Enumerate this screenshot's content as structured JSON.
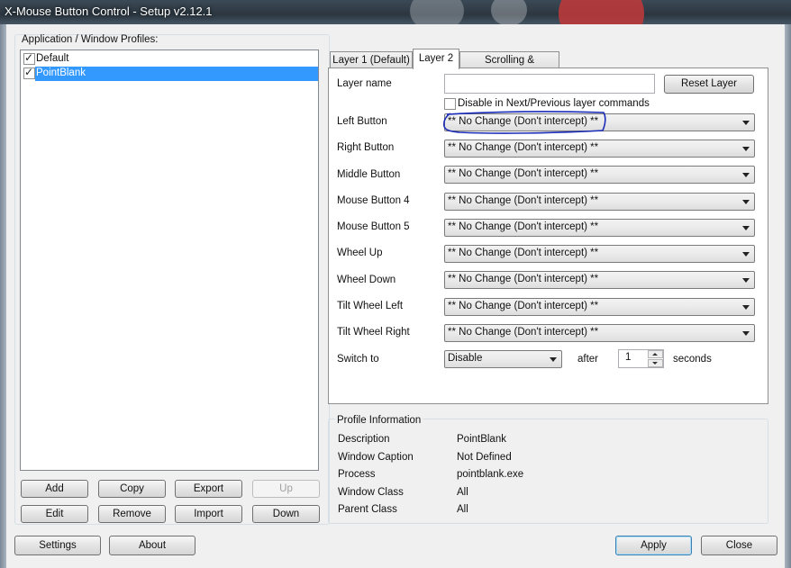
{
  "window": {
    "title": "X-Mouse Button Control - Setup v2.12.1"
  },
  "profiles": {
    "heading": "Application / Window Profiles:",
    "items": [
      {
        "label": "Default",
        "checked": true,
        "selected": false
      },
      {
        "label": "PointBlank",
        "checked": true,
        "selected": true
      }
    ],
    "buttons": {
      "add": "Add",
      "copy": "Copy",
      "export": "Export",
      "up": "Up",
      "edit": "Edit",
      "remove": "Remove",
      "import": "Import",
      "down": "Down"
    }
  },
  "tabs": [
    {
      "label": "Layer 1 (Default)",
      "active": false
    },
    {
      "label": "Layer 2",
      "active": true
    },
    {
      "label": "Scrolling & Navigation",
      "active": false
    }
  ],
  "layer": {
    "name_label": "Layer name",
    "name_value": "",
    "reset_button": "Reset Layer",
    "disable_label": "Disable in Next/Previous layer commands",
    "disable_checked": false,
    "rows": [
      {
        "label": "Left Button",
        "value": "** No Change (Don't intercept) **"
      },
      {
        "label": "Right Button",
        "value": "** No Change (Don't intercept) **"
      },
      {
        "label": "Middle Button",
        "value": "** No Change (Don't intercept) **"
      },
      {
        "label": "Mouse Button 4",
        "value": "** No Change (Don't intercept) **"
      },
      {
        "label": "Mouse Button 5",
        "value": "** No Change (Don't intercept) **"
      },
      {
        "label": "Wheel Up",
        "value": "** No Change (Don't intercept) **"
      },
      {
        "label": "Wheel Down",
        "value": "** No Change (Don't intercept) **"
      },
      {
        "label": "Tilt Wheel Left",
        "value": "** No Change (Don't intercept) **"
      },
      {
        "label": "Tilt Wheel Right",
        "value": "** No Change (Don't intercept) **"
      }
    ],
    "switch_label": "Switch to",
    "switch_value": "Disable",
    "after_label": "after",
    "after_value": "1",
    "seconds_label": "seconds"
  },
  "profile_info": {
    "heading": "Profile Information",
    "rows": [
      {
        "label": "Description",
        "value": "PointBlank"
      },
      {
        "label": "Window Caption",
        "value": "Not Defined"
      },
      {
        "label": "Process",
        "value": "pointblank.exe"
      },
      {
        "label": "Window Class",
        "value": "All"
      },
      {
        "label": "Parent Class",
        "value": "All"
      }
    ]
  },
  "footer": {
    "settings": "Settings",
    "about": "About",
    "apply": "Apply",
    "close": "Close"
  },
  "colors": {
    "selection": "#3399ff",
    "annotation_ink": "#1a2bb8",
    "title_bar": "#2b3640"
  }
}
